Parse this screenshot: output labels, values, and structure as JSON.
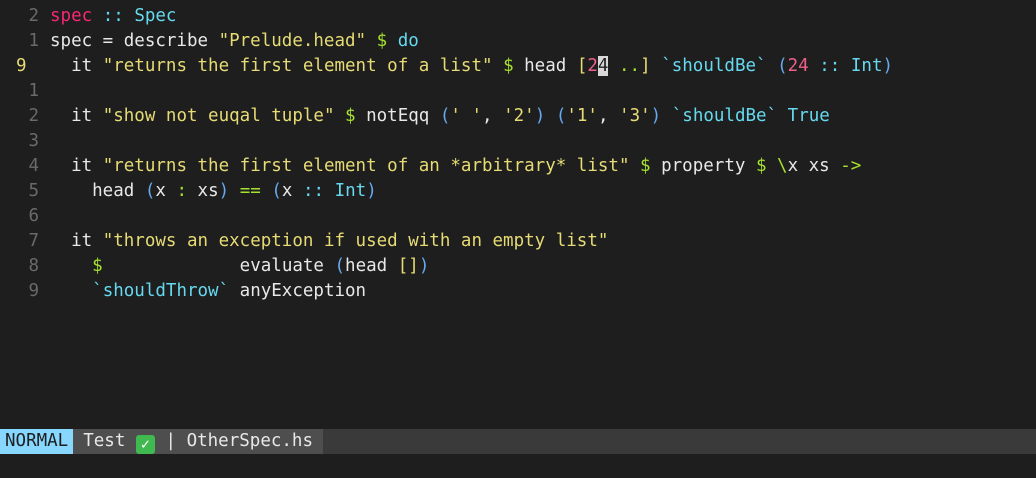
{
  "editor": {
    "lines": [
      {
        "num": "2",
        "current": false,
        "tokens": [
          {
            "t": "kw",
            "v": "spec"
          },
          {
            "t": "",
            "v": " "
          },
          {
            "t": "type",
            "v": "::"
          },
          {
            "t": "",
            "v": " "
          },
          {
            "t": "type",
            "v": "Spec"
          }
        ]
      },
      {
        "num": "1",
        "current": false,
        "tokens": [
          {
            "t": "",
            "v": "spec = describe "
          },
          {
            "t": "str",
            "v": "\"Prelude.head\""
          },
          {
            "t": "",
            "v": " "
          },
          {
            "t": "op",
            "v": "$"
          },
          {
            "t": "",
            "v": " "
          },
          {
            "t": "type",
            "v": "do"
          }
        ]
      },
      {
        "num": "9",
        "current": true,
        "tokens": [
          {
            "t": "",
            "v": "  it "
          },
          {
            "t": "str",
            "v": "\"returns the first element of a list\""
          },
          {
            "t": "",
            "v": " "
          },
          {
            "t": "op",
            "v": "$"
          },
          {
            "t": "",
            "v": " head "
          },
          {
            "t": "brk",
            "v": "["
          },
          {
            "t": "num",
            "v": "2"
          },
          {
            "t": "cursor",
            "v": "4"
          },
          {
            "t": "",
            "v": " "
          },
          {
            "t": "op",
            "v": ".."
          },
          {
            "t": "brk",
            "v": "]"
          },
          {
            "t": "",
            "v": " "
          },
          {
            "t": "bt",
            "v": "`shouldBe`"
          },
          {
            "t": "",
            "v": " "
          },
          {
            "t": "paren",
            "v": "("
          },
          {
            "t": "num",
            "v": "24"
          },
          {
            "t": "",
            "v": " "
          },
          {
            "t": "type",
            "v": "::"
          },
          {
            "t": "",
            "v": " "
          },
          {
            "t": "type",
            "v": "Int"
          },
          {
            "t": "paren",
            "v": ")"
          }
        ]
      },
      {
        "num": "1",
        "current": false,
        "tokens": []
      },
      {
        "num": "2",
        "current": false,
        "tokens": [
          {
            "t": "",
            "v": "  it "
          },
          {
            "t": "str",
            "v": "\"show not euqal tuple\""
          },
          {
            "t": "",
            "v": " "
          },
          {
            "t": "op",
            "v": "$"
          },
          {
            "t": "",
            "v": " notEqq "
          },
          {
            "t": "paren",
            "v": "("
          },
          {
            "t": "str",
            "v": "' '"
          },
          {
            "t": "",
            "v": ", "
          },
          {
            "t": "str",
            "v": "'2'"
          },
          {
            "t": "paren",
            "v": ")"
          },
          {
            "t": "",
            "v": " "
          },
          {
            "t": "paren",
            "v": "("
          },
          {
            "t": "str",
            "v": "'1'"
          },
          {
            "t": "",
            "v": ", "
          },
          {
            "t": "str",
            "v": "'3'"
          },
          {
            "t": "paren",
            "v": ")"
          },
          {
            "t": "",
            "v": " "
          },
          {
            "t": "bt",
            "v": "`shouldBe`"
          },
          {
            "t": "",
            "v": " "
          },
          {
            "t": "type",
            "v": "True"
          }
        ]
      },
      {
        "num": "3",
        "current": false,
        "tokens": []
      },
      {
        "num": "4",
        "current": false,
        "tokens": [
          {
            "t": "",
            "v": "  it "
          },
          {
            "t": "str",
            "v": "\"returns the first element of an *arbitrary* list\""
          },
          {
            "t": "",
            "v": " "
          },
          {
            "t": "op",
            "v": "$"
          },
          {
            "t": "",
            "v": " property "
          },
          {
            "t": "op",
            "v": "$"
          },
          {
            "t": "",
            "v": " "
          },
          {
            "t": "op",
            "v": "\\"
          },
          {
            "t": "",
            "v": "x xs "
          },
          {
            "t": "op",
            "v": "->"
          }
        ]
      },
      {
        "num": "5",
        "current": false,
        "tokens": [
          {
            "t": "",
            "v": "    head "
          },
          {
            "t": "paren",
            "v": "("
          },
          {
            "t": "",
            "v": "x "
          },
          {
            "t": "op",
            "v": ":"
          },
          {
            "t": "",
            "v": " xs"
          },
          {
            "t": "paren",
            "v": ")"
          },
          {
            "t": "",
            "v": " "
          },
          {
            "t": "op",
            "v": "=="
          },
          {
            "t": "",
            "v": " "
          },
          {
            "t": "paren",
            "v": "("
          },
          {
            "t": "",
            "v": "x "
          },
          {
            "t": "type",
            "v": "::"
          },
          {
            "t": "",
            "v": " "
          },
          {
            "t": "type",
            "v": "Int"
          },
          {
            "t": "paren",
            "v": ")"
          }
        ]
      },
      {
        "num": "6",
        "current": false,
        "tokens": []
      },
      {
        "num": "7",
        "current": false,
        "tokens": [
          {
            "t": "",
            "v": "  it "
          },
          {
            "t": "str",
            "v": "\"throws an exception if used with an empty list\""
          }
        ]
      },
      {
        "num": "8",
        "current": false,
        "tokens": [
          {
            "t": "",
            "v": "    "
          },
          {
            "t": "op",
            "v": "$"
          },
          {
            "t": "",
            "v": "             evaluate "
          },
          {
            "t": "paren",
            "v": "("
          },
          {
            "t": "",
            "v": "head "
          },
          {
            "t": "brk",
            "v": "[]"
          },
          {
            "t": "paren",
            "v": ")"
          }
        ]
      },
      {
        "num": "9",
        "current": false,
        "tokens": [
          {
            "t": "",
            "v": "    "
          },
          {
            "t": "bt",
            "v": "`shouldThrow`"
          },
          {
            "t": "",
            "v": " anyException"
          }
        ]
      }
    ]
  },
  "statusline": {
    "mode": "NORMAL",
    "test_label": "Test",
    "test_status_icon": "check-mark-icon",
    "separator": "|",
    "filename": "OtherSpec.hs"
  },
  "colors": {
    "background": "#1e1e1e",
    "keyword": "#f92672",
    "type": "#66d9ef",
    "string": "#e6db74",
    "operator": "#a6e22e",
    "number": "#f0608a",
    "mode_bg": "#87d7ff"
  }
}
